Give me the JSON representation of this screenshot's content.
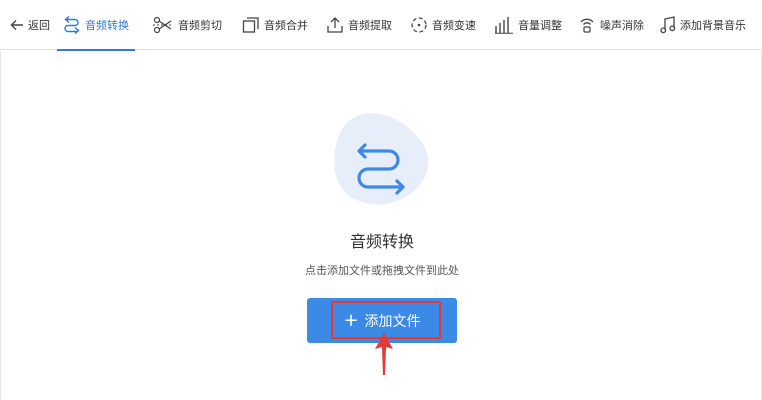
{
  "toolbar": {
    "back": "返回",
    "items": [
      {
        "label": "音频转换",
        "active": true
      },
      {
        "label": "音频剪切"
      },
      {
        "label": "音频合并"
      },
      {
        "label": "音频提取"
      },
      {
        "label": "音频变速"
      },
      {
        "label": "音量调整"
      },
      {
        "label": "噪声消除"
      },
      {
        "label": "添加背景音乐"
      }
    ]
  },
  "main": {
    "title": "音频转换",
    "hint": "点击添加文件或拖拽文件到此处",
    "add_button": {
      "icon": "plus-icon",
      "label": "添加文件"
    }
  },
  "colors": {
    "accent": "#2f7ad8",
    "button": "#3d8ae6",
    "hero_bg": "#e8eef9",
    "annotation": "#e53935"
  }
}
